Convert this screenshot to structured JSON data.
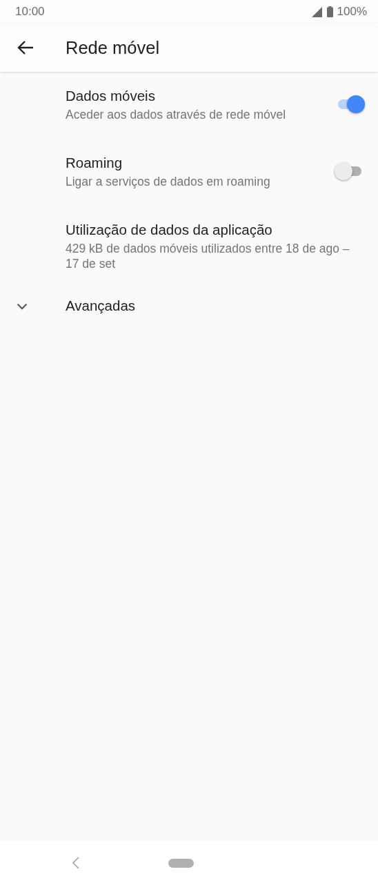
{
  "status_bar": {
    "time": "10:00",
    "battery": "100%"
  },
  "app_bar": {
    "title": "Rede móvel"
  },
  "items": [
    {
      "kind": "switch",
      "title": "Dados móveis",
      "subtitle": "Aceder aos dados através de rede móvel",
      "on": true
    },
    {
      "kind": "switch",
      "title": "Roaming",
      "subtitle": "Ligar a serviços de dados em roaming",
      "on": false
    },
    {
      "kind": "text",
      "title": "Utilização de dados da aplicação",
      "subtitle": "429 kB de dados móveis utilizados entre 18 de ago – 17 de set"
    },
    {
      "kind": "expand",
      "title": "Avançadas",
      "expanded": false
    }
  ]
}
